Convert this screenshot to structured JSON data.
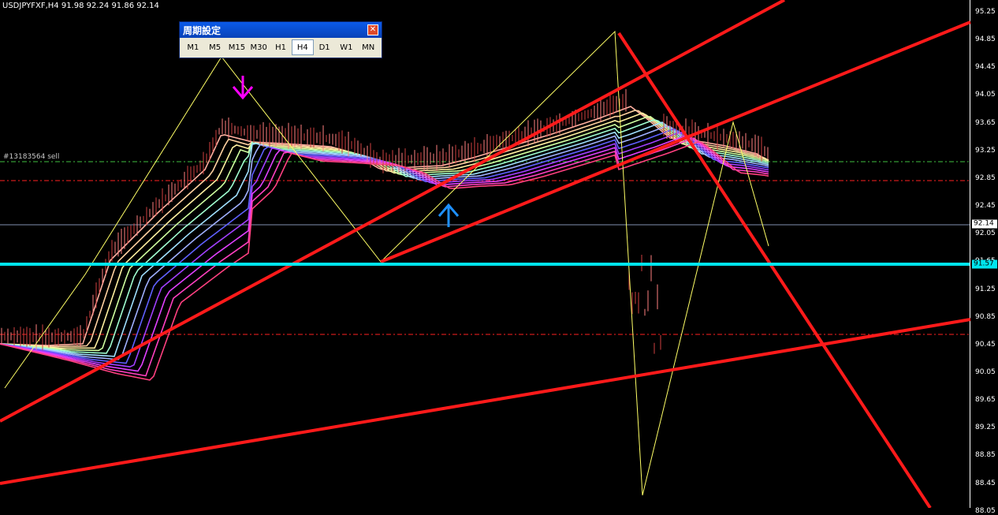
{
  "header": {
    "symbol_line": "USDJPYFXF,H4  91.98 92.24 91.86 92.14"
  },
  "order_label": "#13183564 sell",
  "price_axis": {
    "ticks": [
      "95.25",
      "94.85",
      "94.45",
      "94.05",
      "93.65",
      "93.25",
      "92.85",
      "92.45",
      "92.05",
      "91.65",
      "91.25",
      "90.85",
      "90.45",
      "90.05",
      "89.65",
      "89.25",
      "88.85",
      "88.45",
      "88.05"
    ],
    "current_price": "92.14",
    "horizontal_line_price": "91.57"
  },
  "period_window": {
    "title": "周期設定",
    "close_label": "✕",
    "buttons": [
      "M1",
      "M5",
      "M15",
      "M30",
      "H1",
      "H4",
      "D1",
      "W1",
      "MN"
    ],
    "active": "H4"
  },
  "colors": {
    "background": "#000000",
    "trendline": "#ff1a1a",
    "support_line": "#00e5ee",
    "zigzag": "#ffff66",
    "dash_red": "#ff2020",
    "dash_green": "#40c040",
    "sell_arrow": "#ff00ff",
    "buy_arrow": "#1e90ff"
  }
}
